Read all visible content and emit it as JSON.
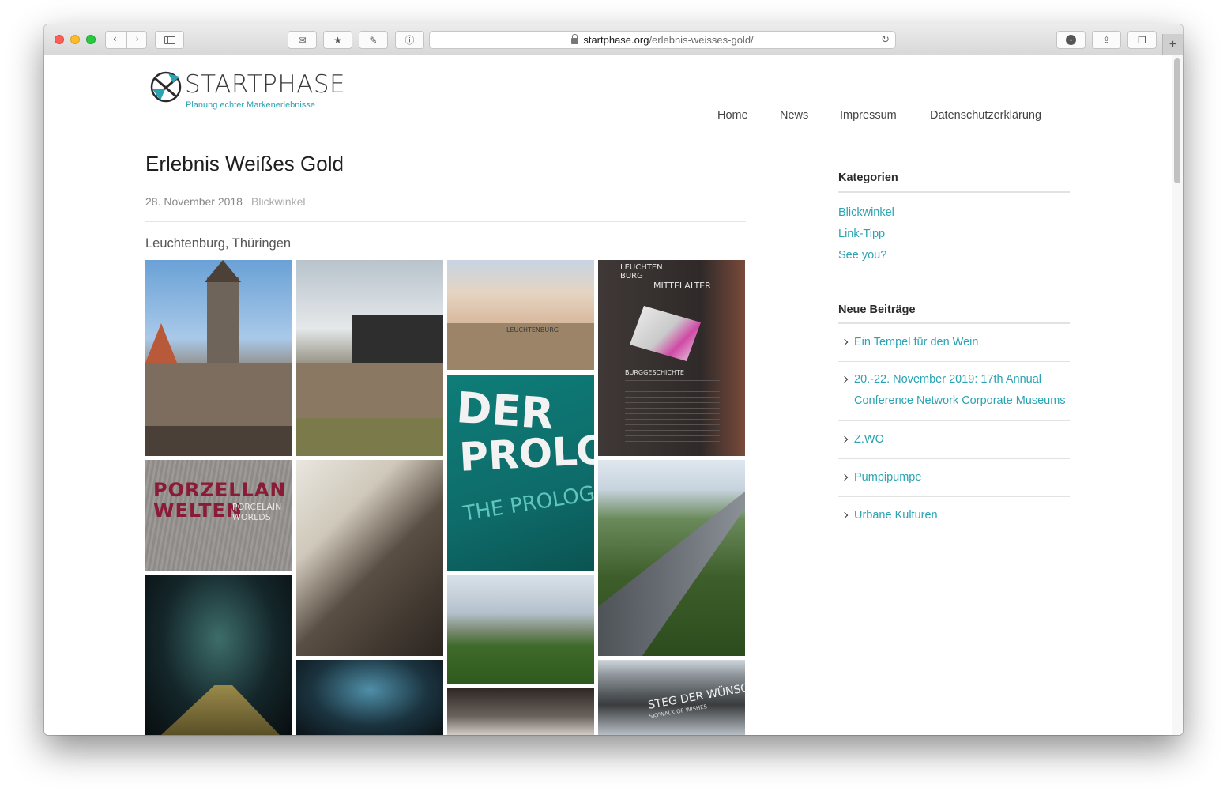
{
  "browser": {
    "url_host": "startphase.org",
    "url_path": "/erlebnis-weisses-gold/"
  },
  "site": {
    "logo_text": "STARTPHASE",
    "tagline": "Planung echter Markenerlebnisse",
    "nav": [
      "Home",
      "News",
      "Impressum",
      "Datenschutzerklärung"
    ]
  },
  "post": {
    "title": "Erlebnis Weißes Gold",
    "date": "28. November 2018",
    "category": "Blickwinkel",
    "subtitle": "Leuchtenburg, Thüringen"
  },
  "gallery": {
    "porzellan_line1": "PORZELLAN",
    "porzellan_line2": "WELTEN",
    "porzellan_en1": "PORCELAIN",
    "porzellan_en2": "WORLDS",
    "prolog_line1": "DER",
    "prolog_line2": "PROLOG",
    "prolog_en": "THE PROLOGUE",
    "map_line1": "LEUCHTEN",
    "map_line2": "BURG",
    "map_line3": "MITTELALTER",
    "map_subhead": "BURGGESCHICHTE",
    "steg_title": "STEG DER WÜNSCHE",
    "steg_sub": "SKYWALK OF WISHES",
    "sign_text": "LEUCHTENBURG"
  },
  "sidebar": {
    "categories_heading": "Kategorien",
    "categories": [
      "Blickwinkel",
      "Link-Tipp",
      "See you?"
    ],
    "recent_heading": "Neue Beiträge",
    "recent": [
      "Ein Tempel für den Wein",
      "20.-22. November 2019: 17th Annual Conference Network Corporate Museums",
      "Z.WO",
      "Pumpipumpe",
      "Urbane Kulturen"
    ]
  },
  "colors": {
    "accent": "#2aa3b2",
    "text": "#1f1f1f"
  }
}
